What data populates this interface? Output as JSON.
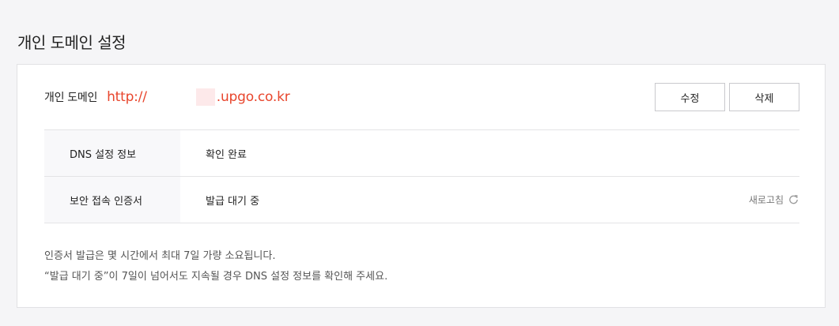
{
  "page": {
    "title": "개인 도메인 설정"
  },
  "domain": {
    "label": "개인 도메인",
    "prefix": "http://",
    "suffix": ".upgo.co.kr",
    "accent_color": "#e8452c"
  },
  "buttons": {
    "edit_label": "수정",
    "delete_label": "삭제"
  },
  "info": {
    "rows": [
      {
        "key": "DNS 설정 정보",
        "value": "확인 완료"
      },
      {
        "key": "보안 접속 인증서",
        "value": "발급 대기 중"
      }
    ],
    "refresh_label": "새로고침",
    "refresh_icon": "refresh-icon"
  },
  "notes": {
    "line1": "인증서 발급은 몇 시간에서 최대 7일 가량 소요됩니다.",
    "line2": "“발급 대기 중”이 7일이 넘어서도 지속될 경우 DNS 설정 정보를 확인해 주세요."
  }
}
